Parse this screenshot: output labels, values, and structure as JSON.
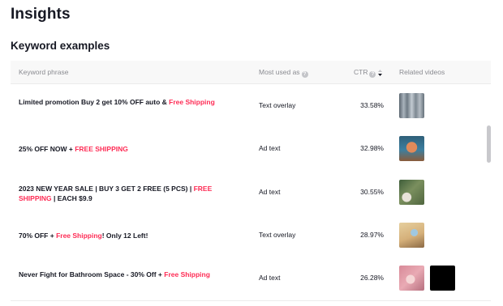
{
  "page": {
    "title": "Insights"
  },
  "section": {
    "title": "Keyword examples"
  },
  "table": {
    "columns": {
      "phrase": "Keyword phrase",
      "used": "Most used as",
      "ctr": "CTR",
      "videos": "Related videos"
    },
    "rows": [
      {
        "phrase_parts": [
          {
            "text": "Limited promotion Buy 2 get 10% OFF auto & ",
            "highlight": false
          },
          {
            "text": "Free Shipping",
            "highlight": true
          }
        ],
        "used_as": "Text overlay",
        "ctr": "33.58%",
        "thumbnails": [
          "video-thumbnail-clothing"
        ]
      },
      {
        "phrase_parts": [
          {
            "text": "25% OFF NOW + ",
            "highlight": false
          },
          {
            "text": "FREE SHIPPING",
            "highlight": true
          }
        ],
        "used_as": "Ad text",
        "ctr": "32.98%",
        "thumbnails": [
          "video-thumbnail-product"
        ]
      },
      {
        "phrase_parts": [
          {
            "text": "2023 NEW YEAR SALE | BUY 3 GET 2 FREE (5 PCS) | ",
            "highlight": false
          },
          {
            "text": "FREE SHIPPING",
            "highlight": true
          },
          {
            "text": " | EACH $9.9",
            "highlight": false
          }
        ],
        "used_as": "Ad text",
        "ctr": "30.55%",
        "thumbnails": [
          "video-thumbnail-outdoor"
        ]
      },
      {
        "phrase_parts": [
          {
            "text": "70% OFF + ",
            "highlight": false
          },
          {
            "text": "Free Shipping",
            "highlight": true
          },
          {
            "text": "! Only 12 Left!",
            "highlight": false
          }
        ],
        "used_as": "Text overlay",
        "ctr": "28.97%",
        "thumbnails": [
          "video-thumbnail-demo"
        ]
      },
      {
        "phrase_parts": [
          {
            "text": "Never Fight for Bathroom Space - 30% Off + ",
            "highlight": false
          },
          {
            "text": "Free Shipping",
            "highlight": true
          }
        ],
        "used_as": "Ad text",
        "ctr": "26.28%",
        "thumbnails": [
          "video-thumbnail-bathroom",
          "video-thumbnail-black"
        ]
      }
    ]
  },
  "icons": {
    "info": "info-icon",
    "sort": "sort-descending-icon"
  },
  "colors": {
    "highlight": "#fe2c55",
    "text": "#161823",
    "muted": "#8a8b91",
    "header_bg": "#f8f8f8"
  }
}
